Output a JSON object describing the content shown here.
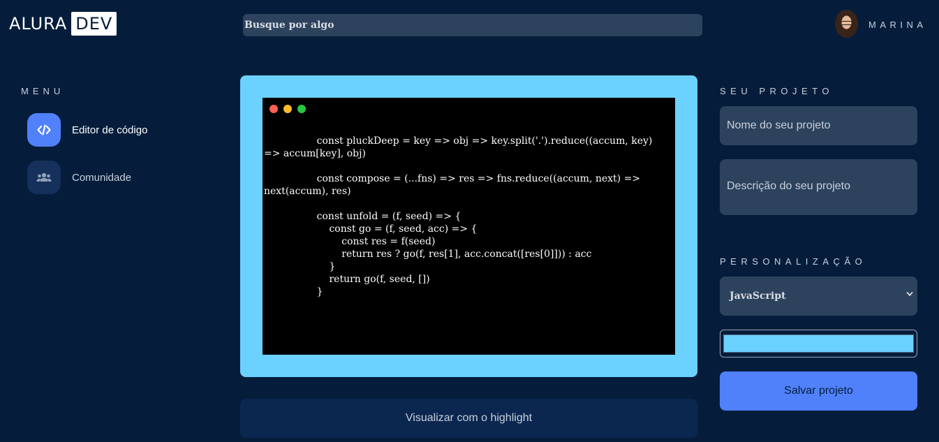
{
  "header": {
    "logo_text": "ALURA",
    "logo_badge": "DEV",
    "search_placeholder": "Busque por algo",
    "username": "MARINA"
  },
  "menu": {
    "title": "MENU",
    "items": [
      {
        "label": "Editor de código",
        "icon": "code-icon",
        "active": true
      },
      {
        "label": "Comunidade",
        "icon": "users-icon",
        "active": false
      }
    ]
  },
  "editor": {
    "background_color": "#6bd1ff",
    "window_dots": [
      "#ff5f56",
      "#ffbd2e",
      "#27c93f"
    ],
    "code": "                 const pluckDeep = key => obj => key.split('.').reduce((accum, key) => accum[key], obj)\n\n                 const compose = (...fns) => res => fns.reduce((accum, next) => next(accum), res)\n\n                 const unfold = (f, seed) => {\n                     const go = (f, seed, acc) => {\n                         const res = f(seed)\n                         return res ? go(f, res[1], acc.concat([res[0]])) : acc\n                     }\n                     return go(f, seed, [])\n                 }",
    "highlight_button": "Visualizar com o highlight"
  },
  "project": {
    "title": "SEU PROJETO",
    "name_placeholder": "Nome do seu projeto",
    "description_placeholder": "Descrição do seu projeto"
  },
  "customization": {
    "title": "PERSONALIZAÇÃO",
    "language": "JavaScript",
    "color": "#6bd1ff",
    "save_button": "Salvar projeto"
  }
}
